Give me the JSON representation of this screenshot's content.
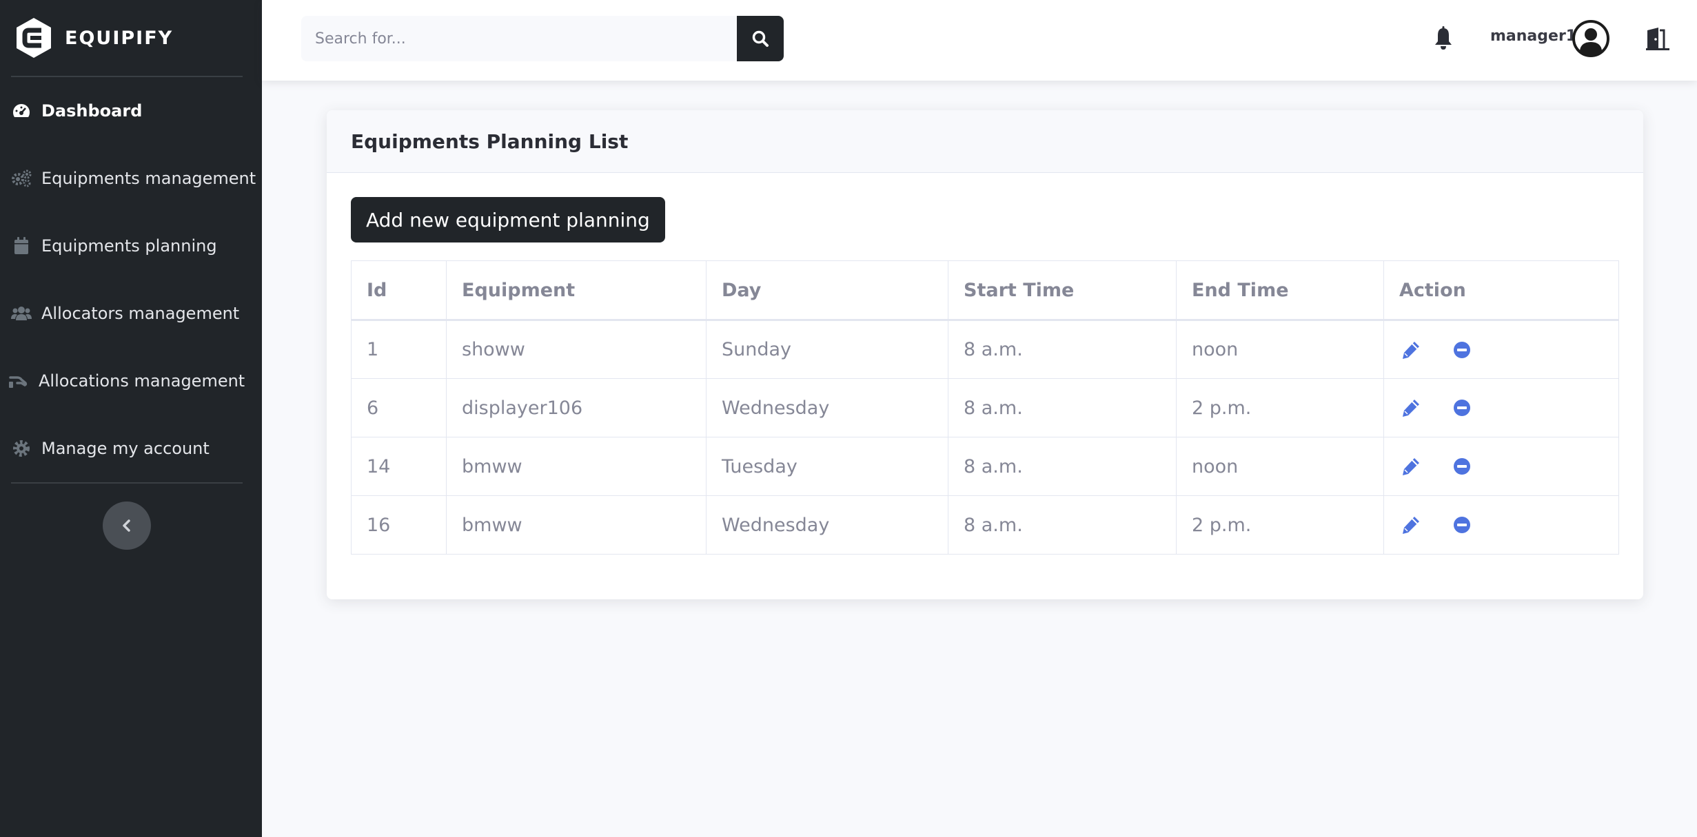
{
  "brand": {
    "name": "EQUIPIFY"
  },
  "sidebar": {
    "items": [
      {
        "label": "Dashboard",
        "icon": "gauge-icon",
        "active": true
      },
      {
        "label": "Equipments management",
        "icon": "gears-icon"
      },
      {
        "label": "Equipments planning",
        "icon": "calendar-icon"
      },
      {
        "label": "Allocators management",
        "icon": "users-icon"
      },
      {
        "label": "Allocations management",
        "icon": "hand-holding-icon"
      },
      {
        "label": "Manage my account",
        "icon": "gear-icon"
      }
    ],
    "collapse_icon": "chevron-left-icon"
  },
  "topbar": {
    "search_placeholder": "Search for...",
    "username": "manager1"
  },
  "card": {
    "title": "Equipments Planning List",
    "add_button": "Add new equipment planning"
  },
  "table": {
    "headers": [
      "Id",
      "Equipment",
      "Day",
      "Start Time",
      "End Time",
      "Action"
    ],
    "rows": [
      {
        "id": "1",
        "equipment": "showw",
        "day": "Sunday",
        "start": "8 a.m.",
        "end": "noon"
      },
      {
        "id": "6",
        "equipment": "displayer106",
        "day": "Wednesday",
        "start": "8 a.m.",
        "end": "2 p.m."
      },
      {
        "id": "14",
        "equipment": "bmww",
        "day": "Tuesday",
        "start": "8 a.m.",
        "end": "noon"
      },
      {
        "id": "16",
        "equipment": "bmww",
        "day": "Wednesday",
        "start": "8 a.m.",
        "end": "2 p.m."
      }
    ]
  },
  "colors": {
    "sidebar_bg": "#212529",
    "accent_icon": "#4e73df",
    "text_muted": "#858796"
  }
}
